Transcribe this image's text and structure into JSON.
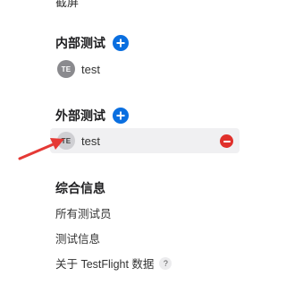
{
  "clipped_top_text": "截屏",
  "internal": {
    "title": "内部测试",
    "testers": [
      {
        "initials": "TE",
        "name": "test"
      }
    ]
  },
  "external": {
    "title": "外部测试",
    "testers": [
      {
        "initials": "TE",
        "name": "test"
      }
    ]
  },
  "general": {
    "title": "综合信息",
    "links": [
      "所有测试员",
      "测试信息",
      "关于 TestFlight 数据"
    ],
    "help_glyph": "?"
  },
  "colors": {
    "accent": "#0a6fe0",
    "remove": "#e0302b",
    "arrow": "#e53935"
  }
}
